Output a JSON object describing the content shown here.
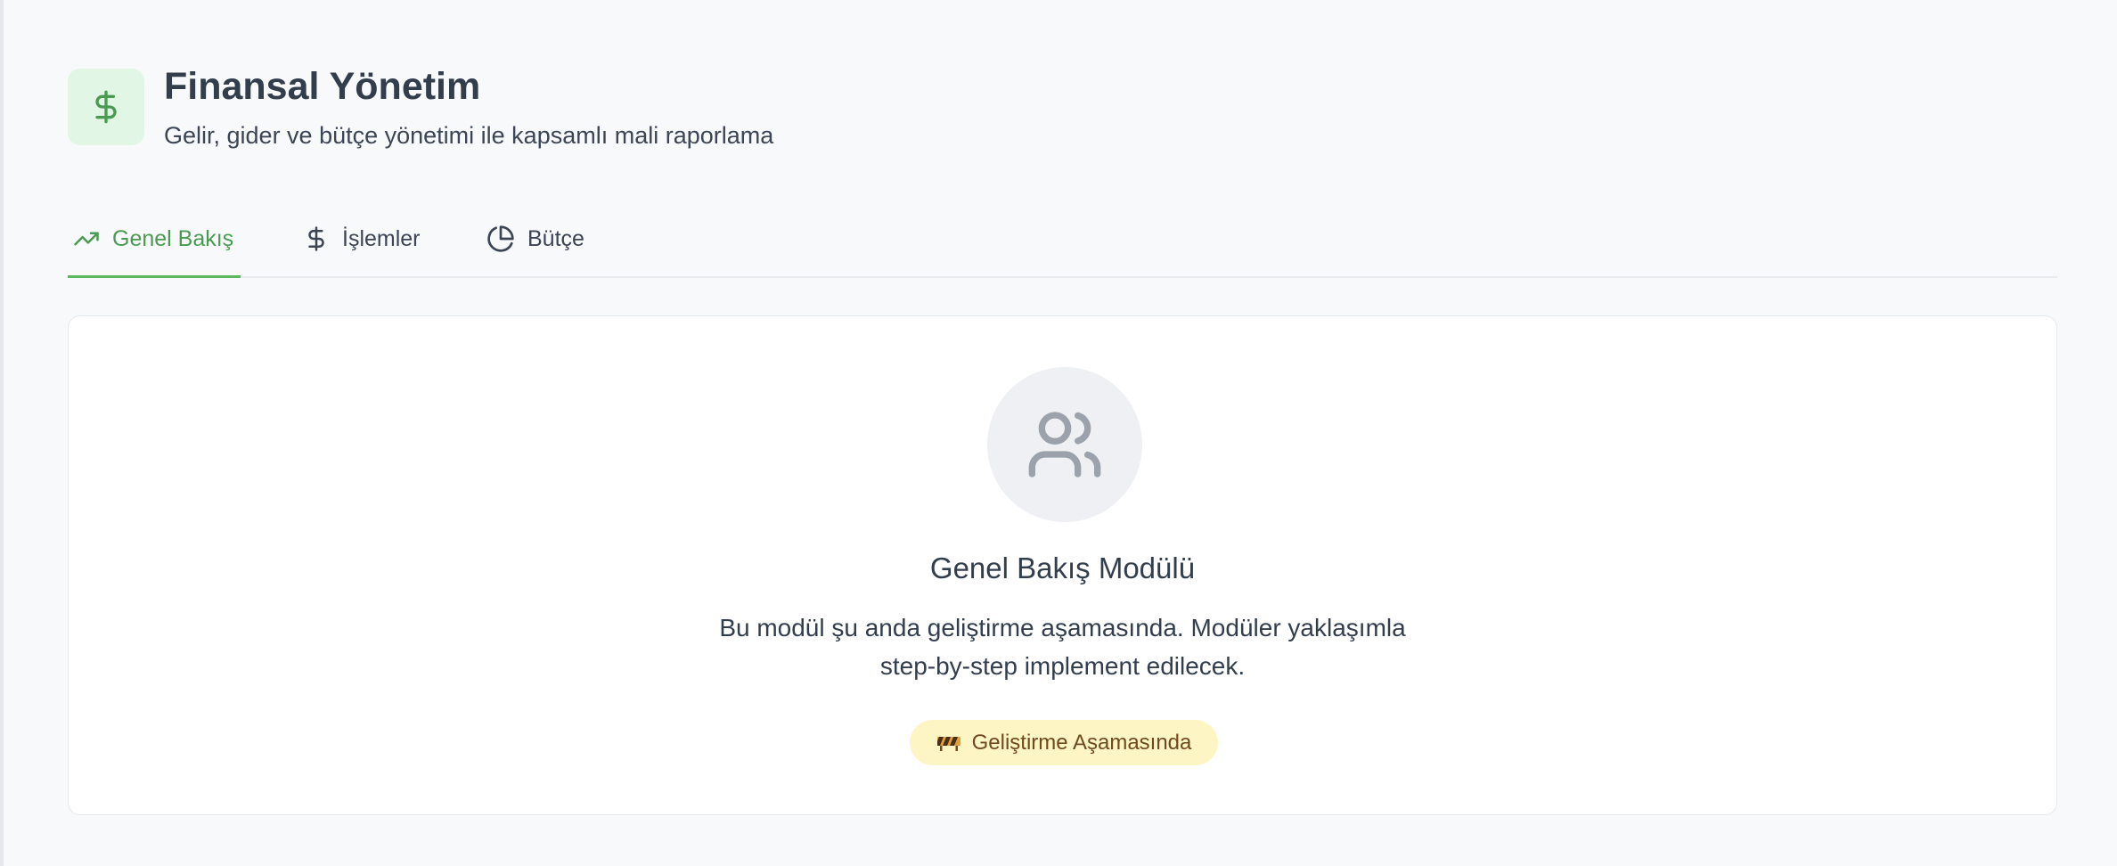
{
  "header": {
    "title": "Finansal Yönetim",
    "subtitle": "Gelir, gider ve bütçe yönetimi ile kapsamlı mali raporlama",
    "icon": "dollar-icon",
    "accent_color": "#4a9b52"
  },
  "tabs": [
    {
      "label": "Genel Bakış",
      "icon": "trending-up-icon",
      "active": true
    },
    {
      "label": "İşlemler",
      "icon": "dollar-icon",
      "active": false
    },
    {
      "label": "Bütçe",
      "icon": "pie-chart-icon",
      "active": false
    }
  ],
  "module": {
    "icon": "users-icon",
    "title": "Genel Bakış Modülü",
    "description_line1": "Bu modül şu anda geliştirme aşamasında. Modüler yaklaşımla",
    "description_line2": "step-by-step implement edilecek.",
    "badge_label": "Geliştirme Aşamasında",
    "badge_icon": "construction-barrier-icon",
    "badge_color": "#fef5c4"
  }
}
